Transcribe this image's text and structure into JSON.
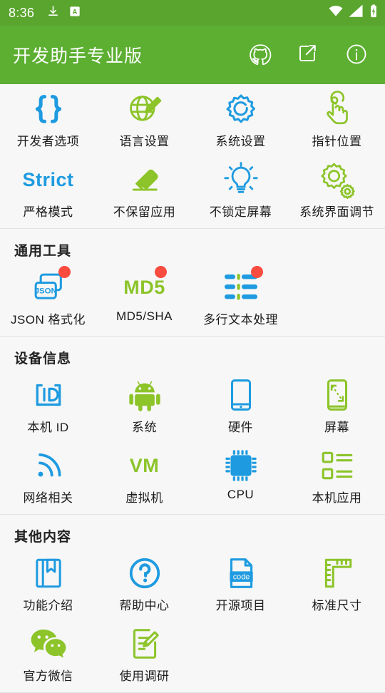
{
  "status_bar": {
    "time": "8:36",
    "left_icons": [
      "download-icon",
      "a-translate-icon"
    ],
    "right_icons": [
      "wifi-icon",
      "signal-icon",
      "battery-charging-icon"
    ]
  },
  "app_bar": {
    "title": "开发助手专业版",
    "actions": [
      {
        "name": "github-icon"
      },
      {
        "name": "share-icon"
      },
      {
        "name": "info-icon"
      }
    ]
  },
  "theme": {
    "status_bar_bg": "#5AA52E",
    "app_bar_bg": "#5CAF31",
    "page_bg": "#F7F7F7",
    "blue": "#1E9BE0",
    "green": "#8CC429",
    "badge_red": "#FC4B3F",
    "label_color": "#1B1B1B"
  },
  "sections": [
    {
      "title": "",
      "items": [
        {
          "label": "开发者选项",
          "icon": "braces-icon",
          "color": "blue",
          "badge": false
        },
        {
          "label": "语言设置",
          "icon": "globe-pencil-icon",
          "color": "green",
          "badge": false
        },
        {
          "label": "系统设置",
          "icon": "gear-icon",
          "color": "blue",
          "badge": false
        },
        {
          "label": "指针位置",
          "icon": "tap-hand-icon",
          "color": "green",
          "badge": false
        },
        {
          "label": "严格模式",
          "icon": "strict-text-icon",
          "color": "blue",
          "badge": false,
          "glyph": "Strict"
        },
        {
          "label": "不保留应用",
          "icon": "eraser-icon",
          "color": "green",
          "badge": false
        },
        {
          "label": "不锁定屏幕",
          "icon": "lightbulb-icon",
          "color": "blue",
          "badge": false
        },
        {
          "label": "系统界面调节",
          "icon": "double-gear-icon",
          "color": "green",
          "badge": false
        }
      ]
    },
    {
      "title": "通用工具",
      "items": [
        {
          "label": "JSON 格式化",
          "icon": "json-icon",
          "color": "blue",
          "badge": true
        },
        {
          "label": "MD5/SHA",
          "icon": "md5-text-icon",
          "color": "green",
          "badge": true,
          "glyph": "MD5"
        },
        {
          "label": "多行文本处理",
          "icon": "multiline-text-icon",
          "color": "blue",
          "badge": true
        }
      ]
    },
    {
      "title": "设备信息",
      "items": [
        {
          "label": "本机 ID",
          "icon": "id-icon",
          "color": "blue",
          "badge": false
        },
        {
          "label": "系统",
          "icon": "android-icon",
          "color": "green",
          "badge": false
        },
        {
          "label": "硬件",
          "icon": "phone-icon",
          "color": "blue",
          "badge": false
        },
        {
          "label": "屏幕",
          "icon": "screen-size-icon",
          "color": "green",
          "badge": false
        },
        {
          "label": "网络相关",
          "icon": "wifi-signal-icon",
          "color": "blue",
          "badge": false
        },
        {
          "label": "虚拟机",
          "icon": "vm-text-icon",
          "color": "green",
          "badge": false,
          "glyph": "VM"
        },
        {
          "label": "CPU",
          "icon": "cpu-chip-icon",
          "color": "blue",
          "badge": false
        },
        {
          "label": "本机应用",
          "icon": "app-list-icon",
          "color": "green",
          "badge": false
        }
      ]
    },
    {
      "title": "其他内容",
      "items": [
        {
          "label": "功能介绍",
          "icon": "book-icon",
          "color": "blue",
          "badge": false
        },
        {
          "label": "帮助中心",
          "icon": "question-icon",
          "color": "blue",
          "badge": false
        },
        {
          "label": "开源项目",
          "icon": "code-file-icon",
          "color": "blue",
          "badge": false,
          "glyph": "code"
        },
        {
          "label": "标准尺寸",
          "icon": "ruler-icon",
          "color": "green",
          "badge": false
        },
        {
          "label": "官方微信",
          "icon": "wechat-icon",
          "color": "green",
          "badge": false
        },
        {
          "label": "使用调研",
          "icon": "survey-edit-icon",
          "color": "green",
          "badge": false
        }
      ]
    }
  ]
}
